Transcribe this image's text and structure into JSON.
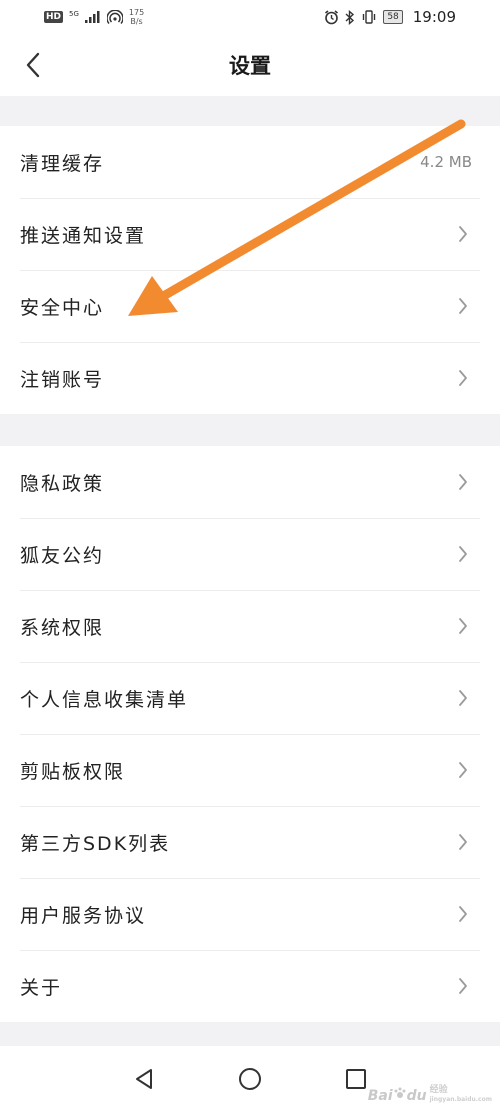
{
  "status_bar": {
    "hd": "HD",
    "net": "5G",
    "speed_value": "175",
    "speed_unit": "B/s",
    "battery": "58",
    "time": "19:09"
  },
  "header": {
    "title": "设置"
  },
  "groups": [
    {
      "items": [
        {
          "label": "清理缓存",
          "value": "4.2 MB"
        },
        {
          "label": "推送通知设置"
        },
        {
          "label": "安全中心"
        },
        {
          "label": "注销账号"
        }
      ]
    },
    {
      "items": [
        {
          "label": "隐私政策"
        },
        {
          "label": "狐友公约"
        },
        {
          "label": "系统权限"
        },
        {
          "label": "个人信息收集清单"
        },
        {
          "label": "剪贴板权限"
        },
        {
          "label": "第三方SDK列表"
        },
        {
          "label": "用户服务协议"
        },
        {
          "label": "关于"
        }
      ]
    }
  ],
  "annotation": {
    "arrow_color": "#f28a30"
  },
  "watermark": {
    "brand": "Bai",
    "brand_tail": "du",
    "sub1": "经验",
    "sub2": "jingyan.baidu.com"
  },
  "icons": {
    "back": "chevron-left-icon",
    "row_arrow": "chevron-right-icon",
    "nav_back": "triangle-back-icon",
    "nav_home": "circle-home-icon",
    "nav_recent": "square-recent-icon"
  }
}
